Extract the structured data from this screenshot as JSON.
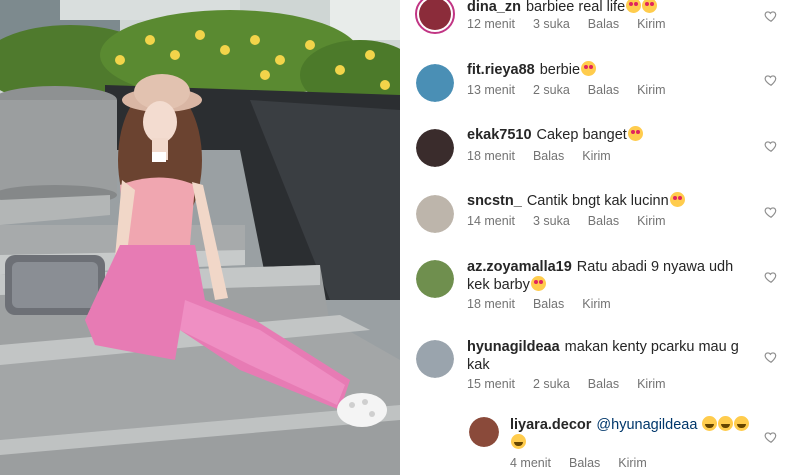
{
  "comments": [
    {
      "username": "dina_zn",
      "text": "barbiee real life",
      "emoji": [
        "love",
        "love"
      ],
      "time": "12 menit",
      "likes": "3 suka",
      "reply_label": "Balas",
      "send_label": "Kirim",
      "avatar_color": "#8b2c3a"
    },
    {
      "username": "fit.rieya88",
      "text": "berbie",
      "emoji": [
        "love"
      ],
      "time": "13 menit",
      "likes": "2 suka",
      "reply_label": "Balas",
      "send_label": "Kirim",
      "avatar_color": "#4a8fb5"
    },
    {
      "username": "ekak7510",
      "text": "Cakep banget",
      "emoji": [
        "love"
      ],
      "time": "18 menit",
      "reply_label": "Balas",
      "send_label": "Kirim",
      "avatar_color": "#3a2c2c"
    },
    {
      "username": "sncstn_",
      "text": "Cantik bngt kak lucinn",
      "emoji": [
        "love"
      ],
      "time": "14 menit",
      "likes": "3 suka",
      "reply_label": "Balas",
      "send_label": "Kirim",
      "avatar_color": "#bdb5ab"
    },
    {
      "username": "az.zoyamalla19",
      "text": "Ratu abadi 9 nyawa udh kek barby",
      "emoji": [
        "love"
      ],
      "time": "18 menit",
      "reply_label": "Balas",
      "send_label": "Kirim",
      "avatar_color": "#6f8f4e"
    },
    {
      "username": "hyunagildeaa",
      "text": "makan kenty pcarku mau g kak",
      "emoji": [],
      "time": "15 menit",
      "likes": "2 suka",
      "reply_label": "Balas",
      "send_label": "Kirim",
      "avatar_color": "#9aa4ad"
    }
  ],
  "reply": {
    "username": "liyara.decor",
    "mention": "@hyunagildeaa",
    "emoji": [
      "laugh",
      "laugh",
      "laugh",
      "laugh"
    ],
    "time": "4 menit",
    "reply_label": "Balas",
    "send_label": "Kirim",
    "avatar_color": "#8a4a3a"
  },
  "colors": {
    "text": "#262626",
    "meta": "#737373",
    "mention": "#00376b",
    "story_ring": "#c13584",
    "emoji_face": "#ffcc4d"
  },
  "icons": {
    "like": "heart-outline-icon"
  }
}
